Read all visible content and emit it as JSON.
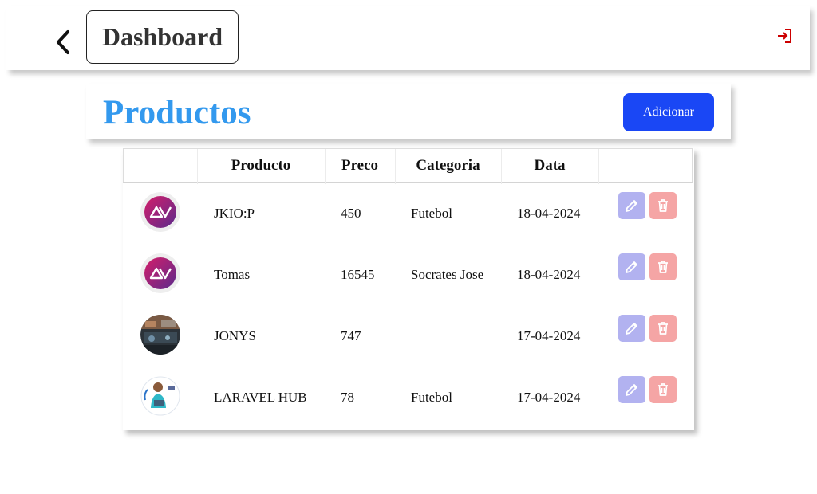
{
  "topbar": {
    "title": "Dashboard"
  },
  "header": {
    "title": "Productos",
    "add_label": "Adicionar"
  },
  "colors": {
    "accent_title": "#3399ee",
    "add_button": "#1a47f5",
    "edit_button": "#b2b2f0",
    "delete_button": "#f5a5a5",
    "logout_icon": "#cc0000"
  },
  "table": {
    "columns": [
      "",
      "Producto",
      "Preco",
      "Categoria",
      "Data",
      ""
    ],
    "rows": [
      {
        "avatar": "brand-logo-icon",
        "name": "JKIO:P",
        "price": "450",
        "category": "Futebol",
        "date": "18-04-2024"
      },
      {
        "avatar": "brand-logo-icon",
        "name": "Tomas",
        "price": "16545",
        "category": "Socrates Jose",
        "date": "18-04-2024"
      },
      {
        "avatar": "tools-photo",
        "name": "JONYS",
        "price": "747",
        "category": "",
        "date": "17-04-2024"
      },
      {
        "avatar": "person-photo",
        "name": "LARAVEL HUB",
        "price": "78",
        "category": "Futebol",
        "date": "17-04-2024"
      }
    ]
  },
  "icons": {
    "back": "chevron-left-icon",
    "logout": "logout-icon",
    "edit": "pencil-icon",
    "delete": "trash-icon"
  }
}
